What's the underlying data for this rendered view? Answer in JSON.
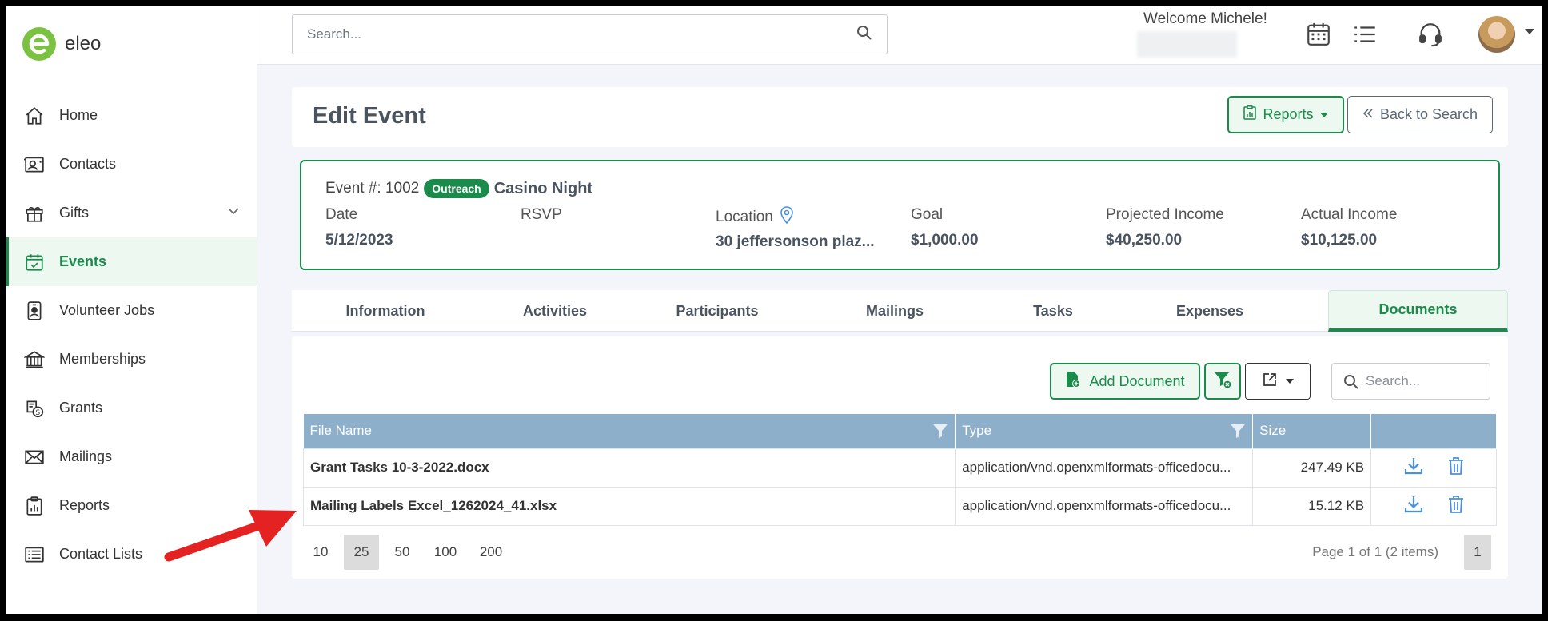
{
  "app": {
    "name": "eleo",
    "logo_letter": "e"
  },
  "sidebar": {
    "items": [
      {
        "label": "Home",
        "icon": "home-icon"
      },
      {
        "label": "Contacts",
        "icon": "contact-card-icon"
      },
      {
        "label": "Gifts",
        "icon": "gift-icon",
        "expandable": true
      },
      {
        "label": "Events",
        "icon": "calendar-check-icon",
        "active": true
      },
      {
        "label": "Volunteer Jobs",
        "icon": "badge-icon"
      },
      {
        "label": "Memberships",
        "icon": "bank-icon"
      },
      {
        "label": "Grants",
        "icon": "money-icon"
      },
      {
        "label": "Mailings",
        "icon": "envelope-icon"
      },
      {
        "label": "Reports",
        "icon": "clipboard-chart-icon"
      },
      {
        "label": "Contact Lists",
        "icon": "list-icon"
      }
    ]
  },
  "header": {
    "search_placeholder": "Search...",
    "welcome": "Welcome Michele!"
  },
  "page": {
    "title": "Edit Event",
    "reports_label": "Reports",
    "back_label": "Back to Search"
  },
  "event": {
    "number_label": "Event #: 1002",
    "badge": "Outreach",
    "name": "Casino Night",
    "fields": [
      {
        "label": "Date",
        "value": "5/12/2023"
      },
      {
        "label": "RSVP",
        "value": ""
      },
      {
        "label": "Location",
        "value": "30 jeffersonson plaz..."
      },
      {
        "label": "Goal",
        "value": "$1,000.00"
      },
      {
        "label": "Projected Income",
        "value": "$40,250.00"
      },
      {
        "label": "Actual Income",
        "value": "$10,125.00"
      }
    ]
  },
  "tabs": [
    "Information",
    "Activities",
    "Participants",
    "Mailings",
    "Tasks",
    "Expenses",
    "Documents"
  ],
  "active_tab": "Documents",
  "documents": {
    "add_label": "Add Document",
    "search_placeholder": "Search...",
    "columns": {
      "file_name": "File Name",
      "type": "Type",
      "size": "Size"
    },
    "rows": [
      {
        "file_name": "Grant Tasks 10-3-2022.docx",
        "type": "application/vnd.openxmlformats-officedocu...",
        "size": "247.49 KB"
      },
      {
        "file_name": "Mailing Labels Excel_1262024_41.xlsx",
        "type": "application/vnd.openxmlformats-officedocu...",
        "size": "15.12 KB"
      }
    ],
    "page_sizes": [
      "10",
      "25",
      "50",
      "100",
      "200"
    ],
    "selected_page_size": "25",
    "page_info": "Page 1 of 1 (2 items)",
    "current_page": "1"
  },
  "colors": {
    "brand_green": "#1a8b4b",
    "logo_green": "#7cc242",
    "grid_header": "#8eafc9",
    "action_blue": "#4a90d9",
    "annotation_red": "#e52222"
  }
}
